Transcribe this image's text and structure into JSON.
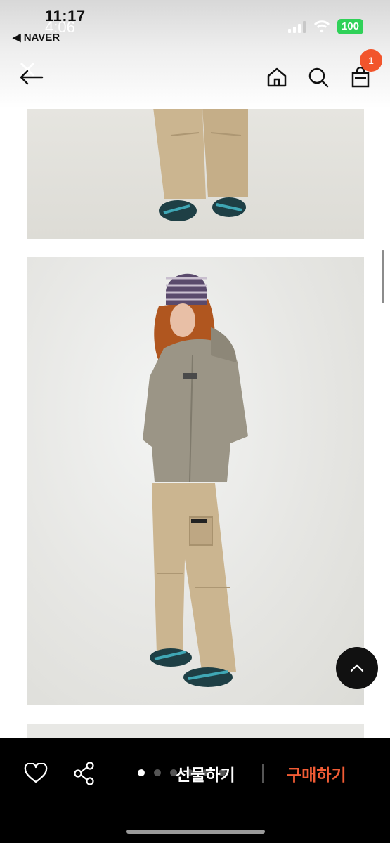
{
  "status_bar": {
    "time_back": "11:17",
    "time_front": "4:06",
    "back_app": "◀ NAVER",
    "battery": "100"
  },
  "nav": {
    "cart_count": "1"
  },
  "product_images": [
    {
      "name": "product-photo-pants-closeup"
    },
    {
      "name": "product-photo-full-outfit"
    },
    {
      "name": "product-photo-next"
    }
  ],
  "bottom_bar": {
    "gift_label": "선물하기",
    "buy_label": "구매하기",
    "pagination_total": 5,
    "pagination_active": 1
  },
  "colors": {
    "accent": "#f25c35",
    "badge": "#f2552c",
    "bar_bg": "#000000"
  }
}
